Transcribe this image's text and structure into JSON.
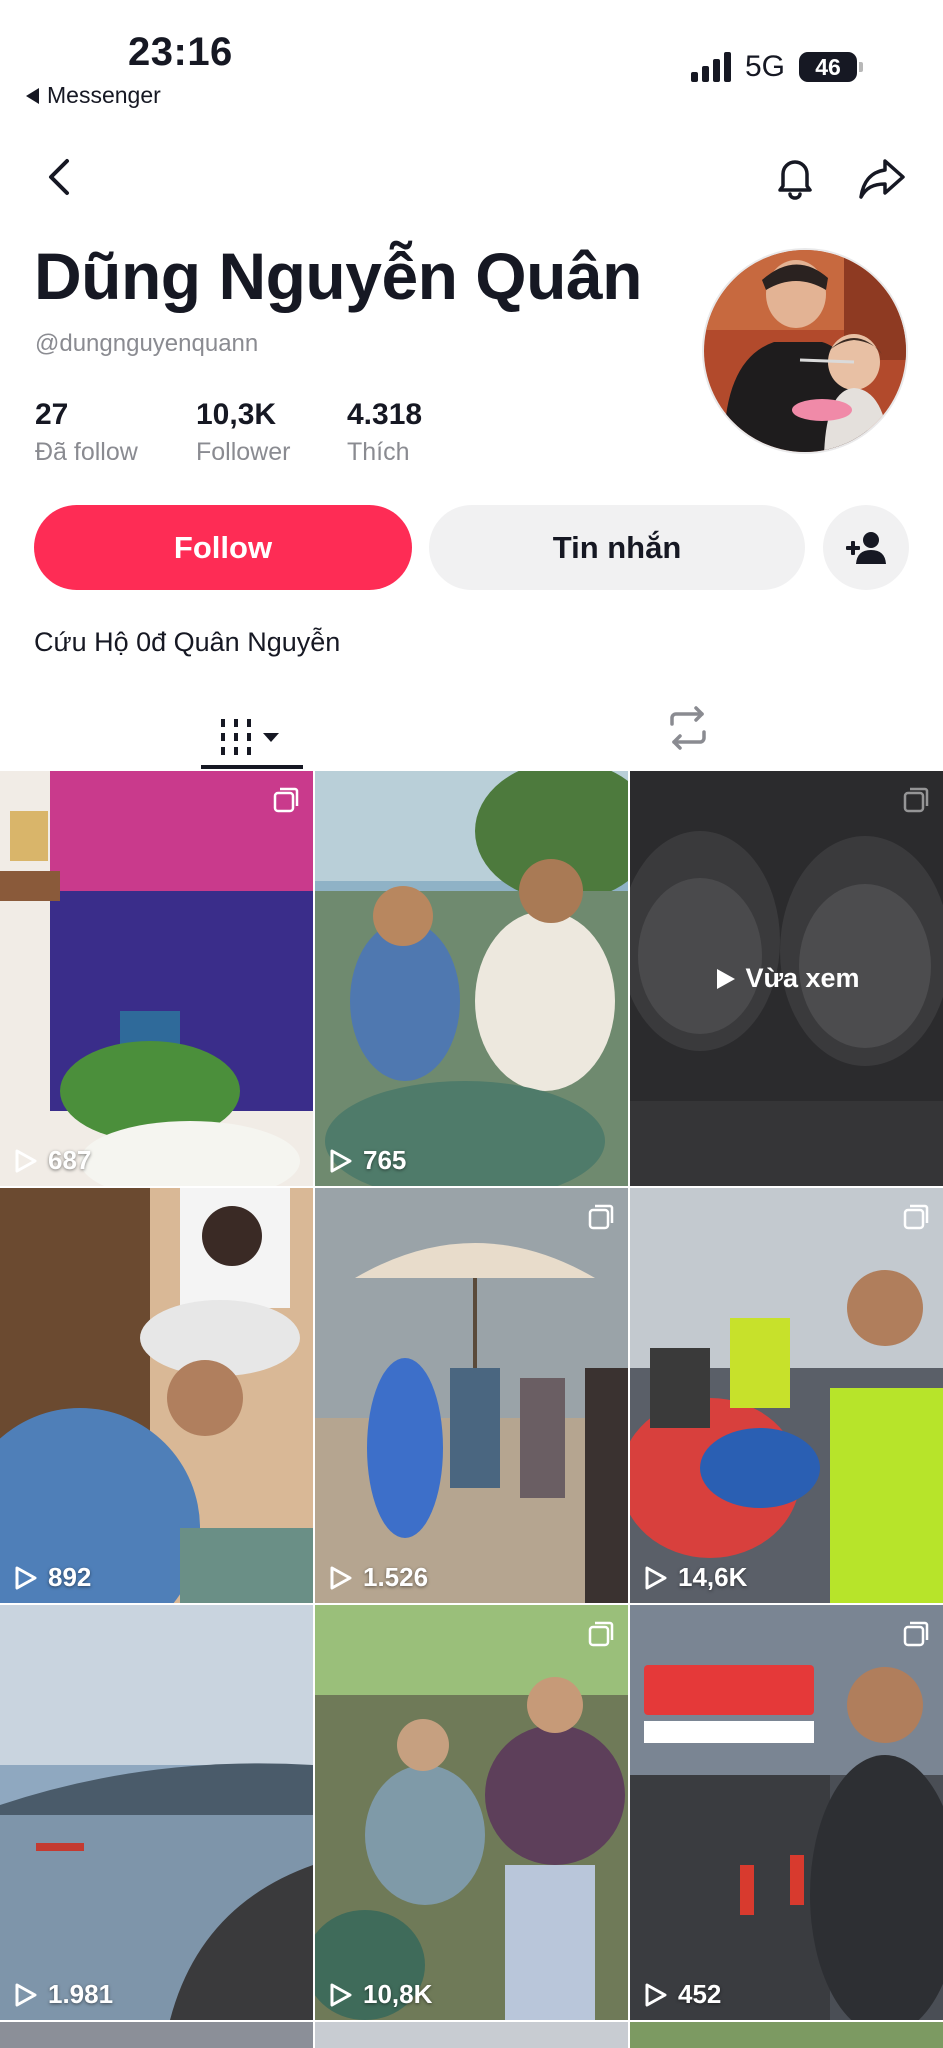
{
  "status_bar": {
    "time": "23:16",
    "back_app": "Messenger",
    "network": "5G",
    "battery": "46"
  },
  "nav": {
    "back_icon": "chevron-left-icon",
    "bell_icon": "bell-icon",
    "share_icon": "share-arrow-icon"
  },
  "profile": {
    "name": "Dũng Nguyễn Quân",
    "handle": "@dungnguyenquann",
    "stats": [
      {
        "value": "27",
        "label": "Đã follow"
      },
      {
        "value": "10,3K",
        "label": "Follower"
      },
      {
        "value": "4.318",
        "label": "Thích"
      }
    ],
    "bio": "Cứu Hộ 0đ Quân Nguyễn"
  },
  "actions": {
    "follow_label": "Follow",
    "message_label": "Tin nhắn",
    "add_friend_icon": "add-person-icon"
  },
  "tabs": {
    "videos_icon": "grid-icon",
    "repost_icon": "repost-icon"
  },
  "videos": [
    {
      "views": "687",
      "overlay": "",
      "multi": true
    },
    {
      "views": "765",
      "overlay": "",
      "multi": false
    },
    {
      "views": "",
      "overlay": "Vừa xem",
      "multi": true
    },
    {
      "views": "892",
      "overlay": "",
      "multi": false
    },
    {
      "views": "1.526",
      "overlay": "",
      "multi": true
    },
    {
      "views": "14,6K",
      "overlay": "",
      "multi": true
    },
    {
      "views": "1.981",
      "overlay": "",
      "multi": false
    },
    {
      "views": "10,8K",
      "overlay": "",
      "multi": true
    },
    {
      "views": "452",
      "overlay": "",
      "multi": true
    }
  ],
  "colors": {
    "accent": "#fe2c55",
    "text": "#161823",
    "muted": "#8a8b91",
    "button_bg": "#f1f1f2"
  }
}
